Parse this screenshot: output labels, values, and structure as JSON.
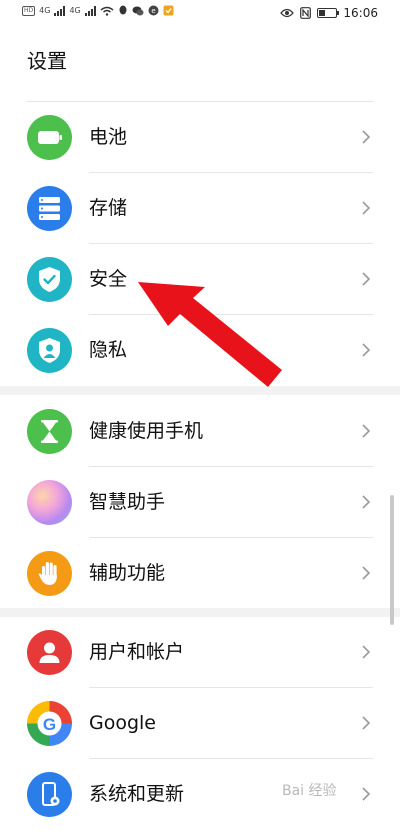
{
  "status_bar": {
    "signal_1": "4G",
    "signal_2": "4G",
    "time": "16:06"
  },
  "page": {
    "title": "设置"
  },
  "items": [
    {
      "label": "电池",
      "icon": "battery-icon",
      "color": "#4cbf4c"
    },
    {
      "label": "存储",
      "icon": "storage-icon",
      "color": "#2b7de9"
    },
    {
      "label": "安全",
      "icon": "shield-check-icon",
      "color": "#1fb5c4"
    },
    {
      "label": "隐私",
      "icon": "privacy-icon",
      "color": "#1fb5c4"
    },
    {
      "label": "健康使用手机",
      "icon": "hourglass-icon",
      "color": "#4cbf4c"
    },
    {
      "label": "智慧助手",
      "icon": "assistant-icon",
      "color": "#c98ef0"
    },
    {
      "label": "辅助功能",
      "icon": "hand-icon",
      "color": "#f59a14"
    },
    {
      "label": "用户和帐户",
      "icon": "user-icon",
      "color": "#e63a3a"
    },
    {
      "label": "Google",
      "icon": "google-icon",
      "color": "#4285f4"
    },
    {
      "label": "系统和更新",
      "icon": "system-update-icon",
      "color": "#2b7de9"
    }
  ],
  "annotation": {
    "arrow_color": "#e8121a"
  },
  "watermark": "Bai 经验"
}
